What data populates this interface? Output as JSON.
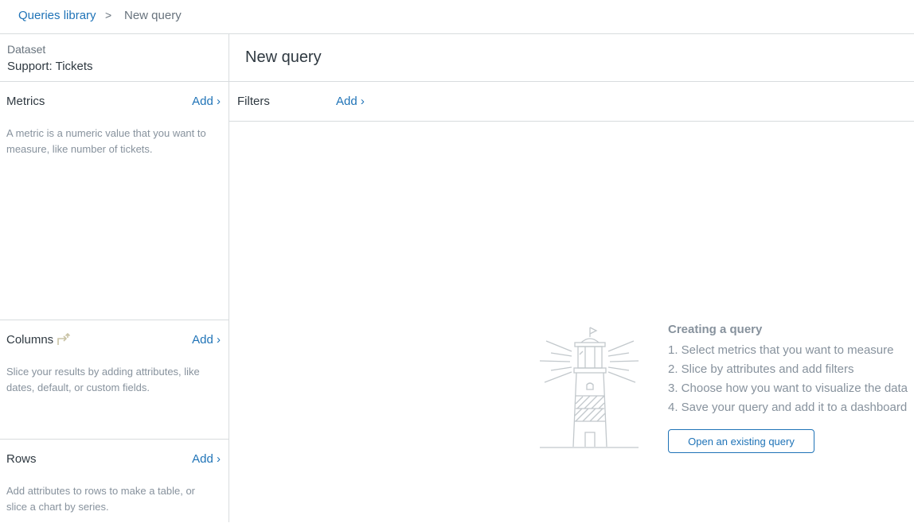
{
  "breadcrumb": {
    "parent": "Queries library",
    "separator": ">",
    "current": "New query"
  },
  "sidebar": {
    "dataset_label": "Dataset",
    "dataset_value": "Support: Tickets",
    "sections": [
      {
        "title": "Metrics",
        "add_label": "Add ›",
        "description": "A metric is a numeric value that you want to measure, like number of tickets."
      },
      {
        "title": "Columns",
        "add_label": "Add ›",
        "description": "Slice your results by adding attributes, like dates, default, or custom fields."
      },
      {
        "title": "Rows",
        "add_label": "Add ›",
        "description": "Add attributes to rows to make a table, or slice a chart by series."
      }
    ]
  },
  "main": {
    "title": "New query",
    "filters_label": "Filters",
    "filters_add_label": "Add ›",
    "guide_title": "Creating a query",
    "guide_steps": [
      "1. Select metrics that you want to measure",
      "2. Slice by attributes and add filters",
      "3. Choose how you want to visualize the data",
      "4. Save your query and add it to a dashboard"
    ],
    "open_button_label": "Open an existing query"
  },
  "icons": {
    "columns_swap": "swap-icon",
    "illustration": "lighthouse-icon"
  },
  "colors": {
    "link": "#1f73b7",
    "border": "#d8dcde",
    "muted_text": "#87929d"
  }
}
